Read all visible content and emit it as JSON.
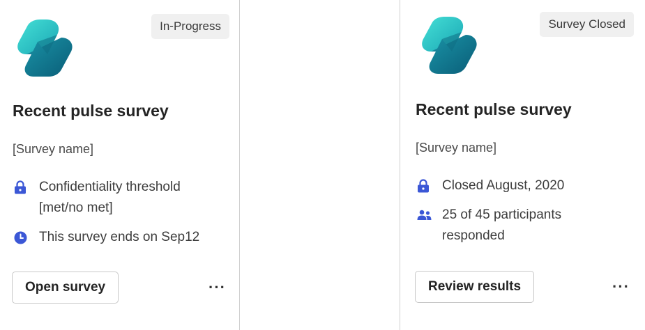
{
  "colors": {
    "accent_icon": "#3b57d6",
    "badge_bg": "#f0f0f0",
    "logo_light": "#3ed6d0",
    "logo_dark": "#0b6f84"
  },
  "cards": [
    {
      "status_badge": "In-Progress",
      "title": "Recent pulse survey",
      "survey_name": "[Survey name]",
      "info": [
        {
          "icon": "lock-icon",
          "text": "Confidentiality threshold [met/no met]"
        },
        {
          "icon": "clock-icon",
          "text": "This survey ends on Sep12"
        }
      ],
      "action_label": "Open survey",
      "more_label": "···"
    },
    {
      "status_badge": "Survey Closed",
      "title": "Recent pulse survey",
      "survey_name": "[Survey name]",
      "info": [
        {
          "icon": "lock-icon",
          "text": "Closed August, 2020"
        },
        {
          "icon": "people-icon",
          "text": "25 of 45 participants responded"
        }
      ],
      "action_label": "Review results",
      "more_label": "···"
    }
  ]
}
